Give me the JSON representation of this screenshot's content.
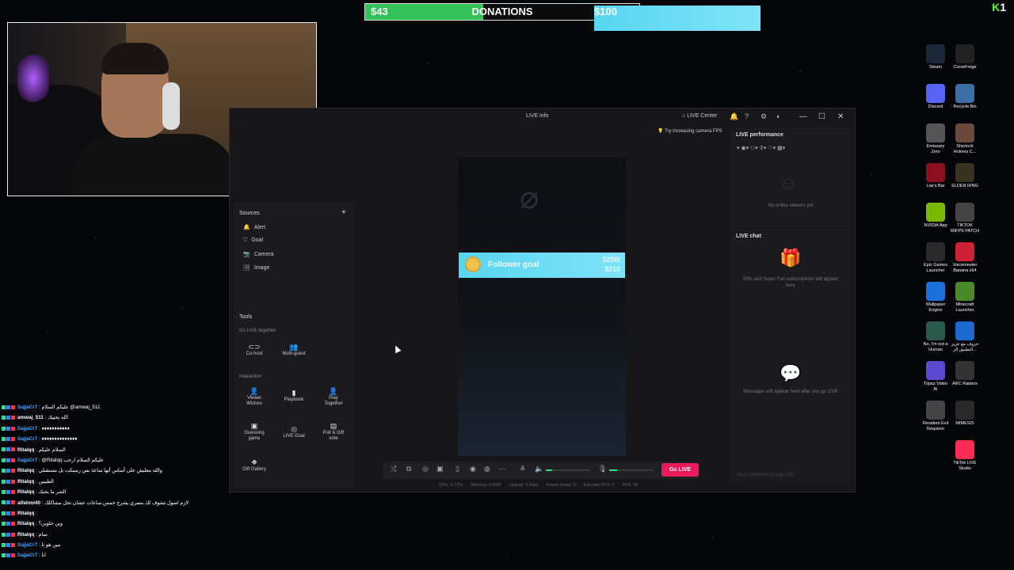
{
  "donations": {
    "current": "$43",
    "title": "DONATIONS",
    "goal": "$100",
    "progress": 0.43,
    "color": "#35c05a"
  },
  "kick_badge": {
    "count": "1"
  },
  "window": {
    "title": "LIVE info",
    "live_center": "LIVE Center",
    "tip": "Try increasing camera FPS",
    "sources_title": "Sources",
    "sources": [
      {
        "icon": "bell-icon",
        "glyph": "🔔",
        "label": "Alert"
      },
      {
        "icon": "goal-icon",
        "glyph": "⛉",
        "label": "Goal"
      },
      {
        "icon": "camera-icon",
        "glyph": "📷",
        "label": "Camera"
      },
      {
        "icon": "image-icon",
        "glyph": "🖼",
        "label": "Image"
      }
    ],
    "tools_title": "Tools",
    "go_live_together": "Go LIVE together",
    "cohost": "Co-host",
    "multiguest": "Multi-guest",
    "interaction": "Interaction",
    "viewer_wishes_1": "Viewer",
    "viewer_wishes_2": "Wishes",
    "playbook": "Playbook",
    "play_together_1": "Play",
    "play_together_2": "Together",
    "guessing_1": "Guessing",
    "guessing_2": "game",
    "live_goal": "LIVE Goal",
    "poll_1": "Poll & Gift",
    "poll_2": "vote",
    "gift_gallery": "Gift Gallery",
    "goal_widget": {
      "label": "Follower goal",
      "value_line1": "3200/",
      "value_line2": "3210"
    },
    "go_live": "Go LIVE",
    "stats": {
      "cpu": "CPU: 0.77%",
      "memory": "Memory: 0.03%",
      "upload": "Upload: 0 kbps",
      "frame_drops": "Frame drops: 0",
      "encoder_fps": "Encoder FPS: 0",
      "fps": "FPS: 60"
    },
    "live_performance": "LIVE performance",
    "no_viewers": "No online viewers yet",
    "live_chat": "LIVE chat",
    "gifts_msg": "Gifts and Super Fan subscriptions will appear here",
    "messages_msg": "Messages will appear here after you go LIVE",
    "chat_placeholder": "Add comments during LIVE"
  },
  "desktop_icons": [
    {
      "name": "steam-icon",
      "l1": "Steam",
      "l2": "",
      "color": "#1b2838"
    },
    {
      "name": "curseforge-icon",
      "l1": "CurseForge",
      "l2": "",
      "color": "#222"
    },
    {
      "name": "discord-icon",
      "l1": "Discord",
      "l2": "",
      "color": "#5865f2"
    },
    {
      "name": "recycle-bin-icon",
      "l1": "Recycle Bin",
      "l2": "",
      "color": "#3a6ea5"
    },
    {
      "name": "emissary-zero-icon",
      "l1": "Emissary",
      "l2": "Zero",
      "color": "#555"
    },
    {
      "name": "sherlock-icon",
      "l1": "Sherlock",
      "l2": "Holmes C...",
      "color": "#6a4a3a"
    },
    {
      "name": "liars-bar-icon",
      "l1": "Liar's Bar",
      "l2": "",
      "color": "#8a1020"
    },
    {
      "name": "elden-ring-icon",
      "l1": "ELDEN RING",
      "l2": "",
      "color": "#3a3220"
    },
    {
      "name": "nvidia-icon",
      "l1": "NVIDIA App",
      "l2": "",
      "color": "#76b900"
    },
    {
      "name": "tiktok-patch-icon",
      "l1": "TIKTOK",
      "l2": "60FPS PATCH",
      "color": "#444"
    },
    {
      "name": "epic-games-icon",
      "l1": "Epic Games",
      "l2": "Launcher",
      "color": "#2a2a2a"
    },
    {
      "name": "voicemeeter-icon",
      "l1": "Voicemeeter",
      "l2": "Banana x64",
      "color": "#c23"
    },
    {
      "name": "wallpaper-engine-icon",
      "l1": "Wallpaper",
      "l2": "Engine",
      "color": "#1e6fd9"
    },
    {
      "name": "minecraft-icon",
      "l1": "Minecraft",
      "l2": "Launcher",
      "color": "#4a8a2a"
    },
    {
      "name": "not-human-icon",
      "l1": "No, I'm not a",
      "l2": "Human",
      "color": "#2a5a4a"
    },
    {
      "name": "arabic-app-icon",
      "l1": "حروف مع عزيز",
      "l2": "التطبيق الر...",
      "color": "#1a6ad0"
    },
    {
      "name": "topaz-icon",
      "l1": "Topaz Video",
      "l2": "AI",
      "color": "#5a4ad0"
    },
    {
      "name": "arc-raiders-icon",
      "l1": "ARC Raiders",
      "l2": "",
      "color": "#333"
    },
    {
      "name": "resident-evil-icon",
      "l1": "Resident Evil",
      "l2": "Requiem",
      "color": "#444"
    },
    {
      "name": "mimesis-icon",
      "l1": "MIMESIS",
      "l2": "",
      "color": "#2a2a2a"
    },
    {
      "name": "tiktok-studio-icon",
      "l1": "TikTok LIVE",
      "l2": "Studio",
      "color": "#fe2c55"
    }
  ],
  "chat": [
    {
      "user": "SajjaCr7",
      "ucolor": "#4aa3ff",
      "text": ": عليكم السلام @amwaj_511"
    },
    {
      "user": "amwaj_511",
      "ucolor": "#fff",
      "text": ": الله يحييك"
    },
    {
      "user": "SajjaCr7",
      "ucolor": "#4aa3ff",
      "text": ": ♦♦♦♦♦♦♦♦♦♦♦"
    },
    {
      "user": "SajjaCr7",
      "ucolor": "#4aa3ff",
      "text": ": ♦♦♦♦♦♦♦♦♦♦♦♦♦♦"
    },
    {
      "user": "Ritalqq",
      "ucolor": "#fff",
      "text": ": السلام عليكم"
    },
    {
      "user": "SajjaCr7",
      "ucolor": "#4aa3ff",
      "text": ": @Ritalqq عليكم السلام ارحب"
    },
    {
      "user": "Ritalqq",
      "ucolor": "#fff",
      "text": ": والله معليش على أساس أنها ساعة بس رسيكت بل مستقبلي"
    },
    {
      "user": "Ritalqq",
      "ucolor": "#fff",
      "text": ": الطيبين"
    },
    {
      "user": "Ritalqq",
      "ucolor": "#fff",
      "text": ": الشر ما يجيك"
    },
    {
      "user": "alfahmi40",
      "ucolor": "#fff",
      "text": ": لازم اصول تشوف لك مصري يشرح خمس ساعات عشان تحل مشاكلك"
    },
    {
      "user": "Ritalqq",
      "ucolor": "#fff",
      "text": ":"
    },
    {
      "user": "Ritalqq",
      "ucolor": "#fff",
      "text": ": وين حلوين؟"
    },
    {
      "user": "Ritalqq",
      "ucolor": "#fff",
      "text": ": تمام"
    },
    {
      "user": "SajjaCr7",
      "ucolor": "#4aa3ff",
      "text": ": مين هو نا"
    },
    {
      "user": "SajjaCr7",
      "ucolor": "#4aa3ff",
      "text": ": انا"
    }
  ]
}
